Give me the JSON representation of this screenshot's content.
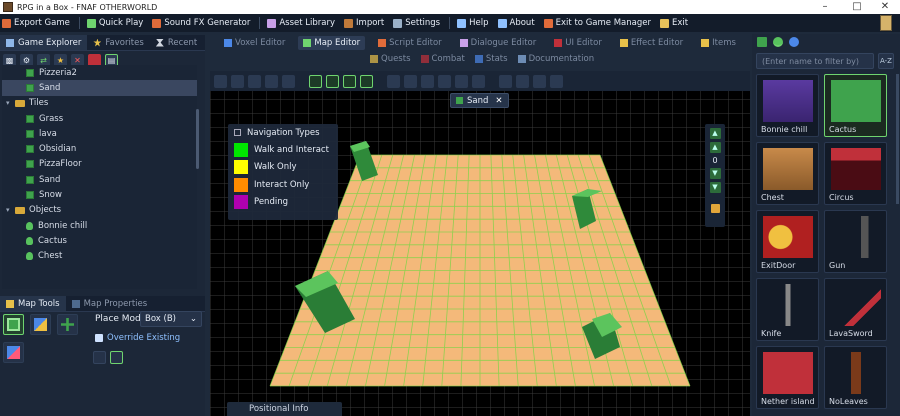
{
  "window": {
    "title": "RPG in a Box - FNAF OTHERWORLD"
  },
  "menu": [
    {
      "label": "Export Game",
      "icon": "export-icon",
      "color": "#e6ecf5"
    },
    {
      "label": "Quick Play",
      "icon": "play-icon",
      "color": "#e6ecf5"
    },
    {
      "label": "Sound FX Generator",
      "icon": "speaker-icon",
      "color": "#e6ecf5"
    },
    {
      "label": "Asset Library",
      "icon": "asset-icon",
      "color": "#e6ecf5"
    },
    {
      "label": "Import",
      "icon": "import-icon",
      "color": "#e6ecf5"
    },
    {
      "label": "Settings",
      "icon": "gear-icon",
      "color": "#e6ecf5"
    },
    {
      "label": "Help",
      "icon": "help-icon",
      "color": "#e6ecf5"
    },
    {
      "label": "About",
      "icon": "info-icon",
      "color": "#e6ecf5"
    },
    {
      "label": "Exit to Game Manager",
      "icon": "exit-manager-icon",
      "color": "#e6ecf5"
    },
    {
      "label": "Exit",
      "icon": "exit-icon",
      "color": "#e6ecf5"
    }
  ],
  "left": {
    "tabs": [
      {
        "label": "Game Explorer",
        "active": true
      },
      {
        "label": "Favorites",
        "active": false
      },
      {
        "label": "Recent",
        "active": false
      }
    ],
    "tree": [
      {
        "label": "Pizzeria2",
        "type": "leaf",
        "indent": 1,
        "selected": false
      },
      {
        "label": "Sand",
        "type": "leaf",
        "indent": 1,
        "selected": true
      },
      {
        "label": "Tiles",
        "type": "folder",
        "indent": 0,
        "selected": false
      },
      {
        "label": "Grass",
        "type": "leaf",
        "indent": 1,
        "selected": false
      },
      {
        "label": "lava",
        "type": "leaf",
        "indent": 1,
        "selected": false
      },
      {
        "label": "Obsidian",
        "type": "leaf",
        "indent": 1,
        "selected": false
      },
      {
        "label": "PizzaFloor",
        "type": "leaf",
        "indent": 1,
        "selected": false
      },
      {
        "label": "Sand",
        "type": "leaf",
        "indent": 1,
        "selected": false
      },
      {
        "label": "Snow",
        "type": "leaf",
        "indent": 1,
        "selected": false
      },
      {
        "label": "Objects",
        "type": "folder",
        "indent": 0,
        "selected": false
      },
      {
        "label": "Bonnie chill",
        "type": "bulb",
        "indent": 1,
        "selected": false
      },
      {
        "label": "Cactus",
        "type": "bulb",
        "indent": 1,
        "selected": false
      },
      {
        "label": "Chest",
        "type": "bulb",
        "indent": 1,
        "selected": false
      }
    ],
    "map_tools_tab": "Map Tools",
    "map_props_tab": "Map Properties",
    "place_mode_label": "Place Mode:",
    "place_mode_value": "Box (B)",
    "override_label": "Override Existing"
  },
  "editor_tabs": [
    {
      "label": "Voxel Editor",
      "active": false
    },
    {
      "label": "Map Editor",
      "active": true
    },
    {
      "label": "Script Editor",
      "active": false
    },
    {
      "label": "Dialogue Editor",
      "active": false
    },
    {
      "label": "UI Editor",
      "active": false
    },
    {
      "label": "Effect Editor",
      "active": false
    },
    {
      "label": "Items",
      "active": false
    }
  ],
  "sub_tabs": [
    "Quests",
    "Combat",
    "Stats",
    "Documentation"
  ],
  "viewport": {
    "sand_tab": "Sand",
    "nav_title": "Navigation Types",
    "nav_types": [
      {
        "label": "Walk and Interact",
        "color": "#00e600"
      },
      {
        "label": "Walk Only",
        "color": "#ffff00"
      },
      {
        "label": "Interact Only",
        "color": "#ff8c00"
      },
      {
        "label": "Pending",
        "color": "#b000b0"
      }
    ],
    "zoom_value": "0",
    "positional_info": "Positional Info"
  },
  "right": {
    "filter_placeholder": "(Enter name to filter by)",
    "filter_btn": "A-Z",
    "assets": [
      {
        "label": "Bonnie chill",
        "selected": false
      },
      {
        "label": "Cactus",
        "selected": true
      },
      {
        "label": "Chest",
        "selected": false
      },
      {
        "label": "Circus",
        "selected": false
      },
      {
        "label": "ExitDoor",
        "selected": false
      },
      {
        "label": "Gun",
        "selected": false
      },
      {
        "label": "Knife",
        "selected": false
      },
      {
        "label": "LavaSword",
        "selected": false
      },
      {
        "label": "Nether island",
        "selected": false
      },
      {
        "label": "NoLeaves",
        "selected": false
      }
    ]
  }
}
